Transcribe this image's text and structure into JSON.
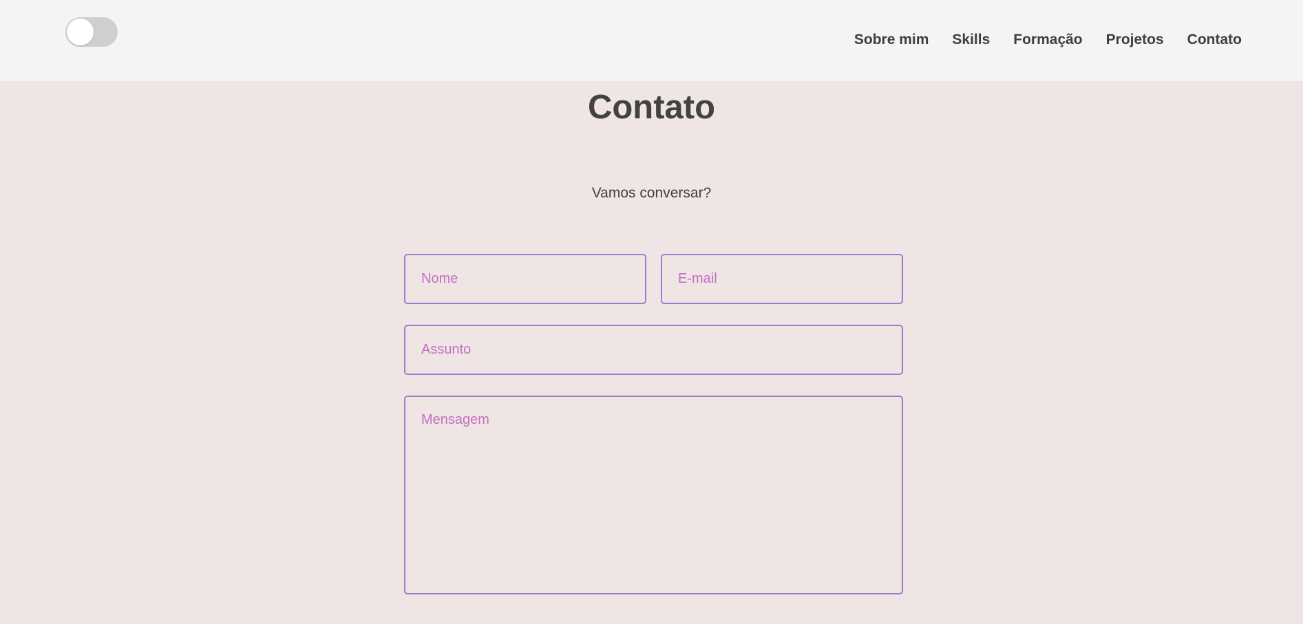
{
  "nav": {
    "items": [
      {
        "label": "Sobre mim"
      },
      {
        "label": "Skills"
      },
      {
        "label": "Formação"
      },
      {
        "label": "Projetos"
      },
      {
        "label": "Contato"
      }
    ]
  },
  "theme_toggle": {
    "state": "off"
  },
  "contact": {
    "title": "Contato",
    "subtitle": "Vamos conversar?",
    "form": {
      "name_placeholder": "Nome",
      "name_value": "",
      "email_placeholder": "E-mail",
      "email_value": "",
      "subject_placeholder": "Assunto",
      "subject_value": "",
      "message_placeholder": "Mensagem",
      "message_value": ""
    }
  },
  "colors": {
    "header_bg": "#f4f4f4",
    "page_bg": "#f0e5e5",
    "field_border": "#a07bc9",
    "placeholder": "#c46fc0",
    "text": "#3f3f3f"
  }
}
